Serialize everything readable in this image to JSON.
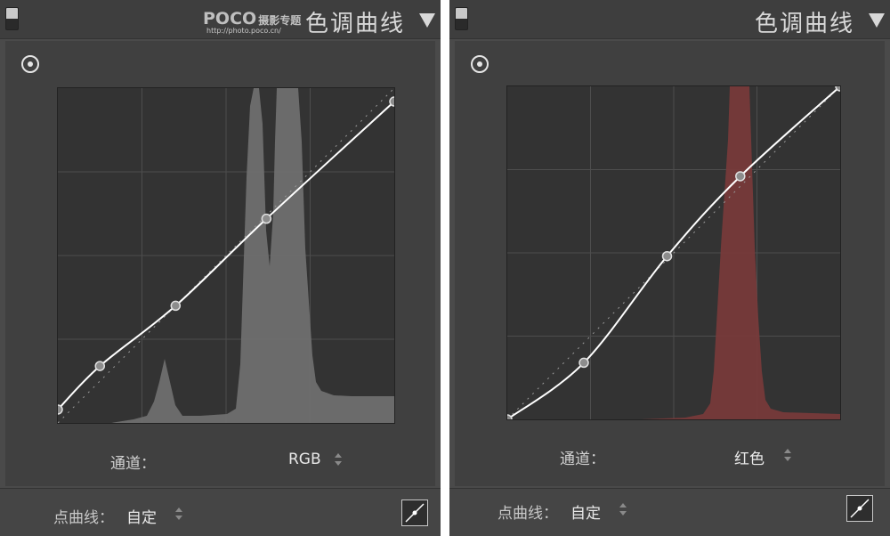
{
  "watermark": {
    "brand": "POCO",
    "subtitle": "摄影专题",
    "url": "http://photo.poco.cn/"
  },
  "left_panel": {
    "title": "色调曲线",
    "channel": {
      "label": "通道：",
      "value": "RGB"
    },
    "point_curve": {
      "label": "点曲线：",
      "value": "自定"
    },
    "curve_points": [
      [
        0,
        0.04
      ],
      [
        0.125,
        0.17
      ],
      [
        0.35,
        0.35
      ],
      [
        0.62,
        0.61
      ],
      [
        1.0,
        0.96
      ]
    ],
    "curve_color": "#ffffff",
    "histogram_color": "#6f6f6f"
  },
  "right_panel": {
    "title": "色调曲线",
    "channel": {
      "label": "通道：",
      "value": "红色"
    },
    "point_curve": {
      "label": "点曲线：",
      "value": "自定"
    },
    "curve_points": [
      [
        0,
        0.0
      ],
      [
        0.23,
        0.17
      ],
      [
        0.48,
        0.49
      ],
      [
        0.7,
        0.73
      ],
      [
        1.0,
        1.0
      ]
    ],
    "curve_color": "#ffffff",
    "histogram_color": "#7a3a3a"
  }
}
